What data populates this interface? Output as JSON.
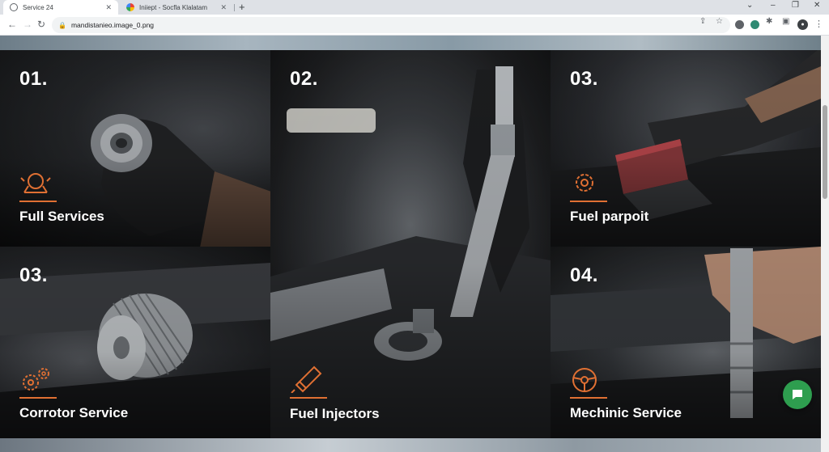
{
  "browser": {
    "tabs": [
      {
        "title": "Service 24",
        "active": true,
        "favicon": "globe-icon"
      },
      {
        "title": "Iniiept - Socfla Klalatam",
        "active": false,
        "favicon": "google-icon"
      }
    ],
    "new_tab": "+",
    "close_glyph": "✕",
    "window_controls": {
      "minimize": "–",
      "restore": "❐",
      "close": "✕",
      "tab_search": "⌄"
    },
    "url": "mandistanieo.image_0.png"
  },
  "cards": [
    {
      "number": "01.",
      "label": "Full Services",
      "icon": "engine-service-icon"
    },
    {
      "number": "02.",
      "label": "Fuel Injectors",
      "icon": "fuel-injector-icon"
    },
    {
      "number": "03.",
      "label": "Fuel parpoit",
      "icon": "gear-wrench-icon"
    },
    {
      "number": "03.",
      "label": "Corrotor Service",
      "icon": "gears-icon"
    },
    {
      "number": "04.",
      "label": "Mechinic Service",
      "icon": "steering-wheel-icon"
    }
  ],
  "colors": {
    "accent": "#e07033",
    "chat": "#2e9e4f",
    "text": "#ffffff"
  }
}
